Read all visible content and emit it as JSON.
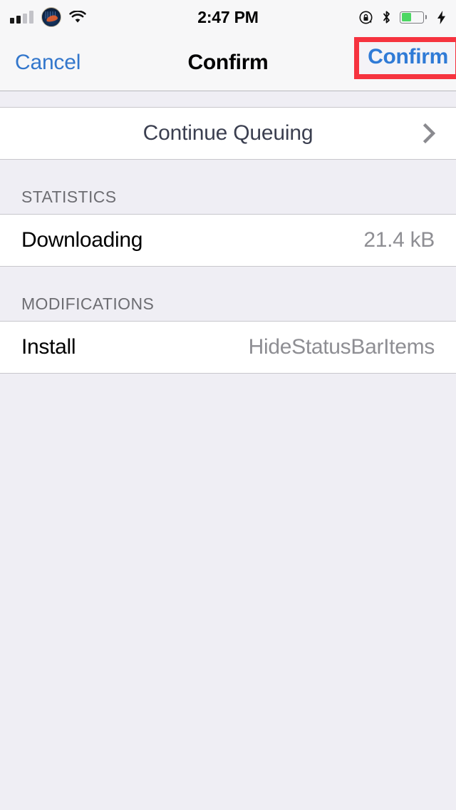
{
  "status_bar": {
    "time": "2:47 PM",
    "signal_bars_total": 4,
    "signal_bars_filled": 2,
    "carrier_logo": "ny-mets-logo",
    "wifi": "wifi-icon",
    "rotation_lock": "rotation-lock-icon",
    "bluetooth": "bluetooth-icon",
    "battery_percent": 45,
    "battery_color": "#4cd763",
    "charging": true
  },
  "nav_bar": {
    "cancel_label": "Cancel",
    "title": "Confirm",
    "confirm_label": "Confirm",
    "highlight_color": "#f6333f",
    "tint_color": "#3377cc"
  },
  "action_row": {
    "label": "Continue Queuing",
    "accessory": "chevron-right-icon"
  },
  "sections": [
    {
      "header": "STATISTICS",
      "rows": [
        {
          "label": "Downloading",
          "value": "21.4 kB"
        }
      ]
    },
    {
      "header": "MODIFICATIONS",
      "rows": [
        {
          "label": "Install",
          "value": "HideStatusBarItems"
        }
      ]
    }
  ]
}
